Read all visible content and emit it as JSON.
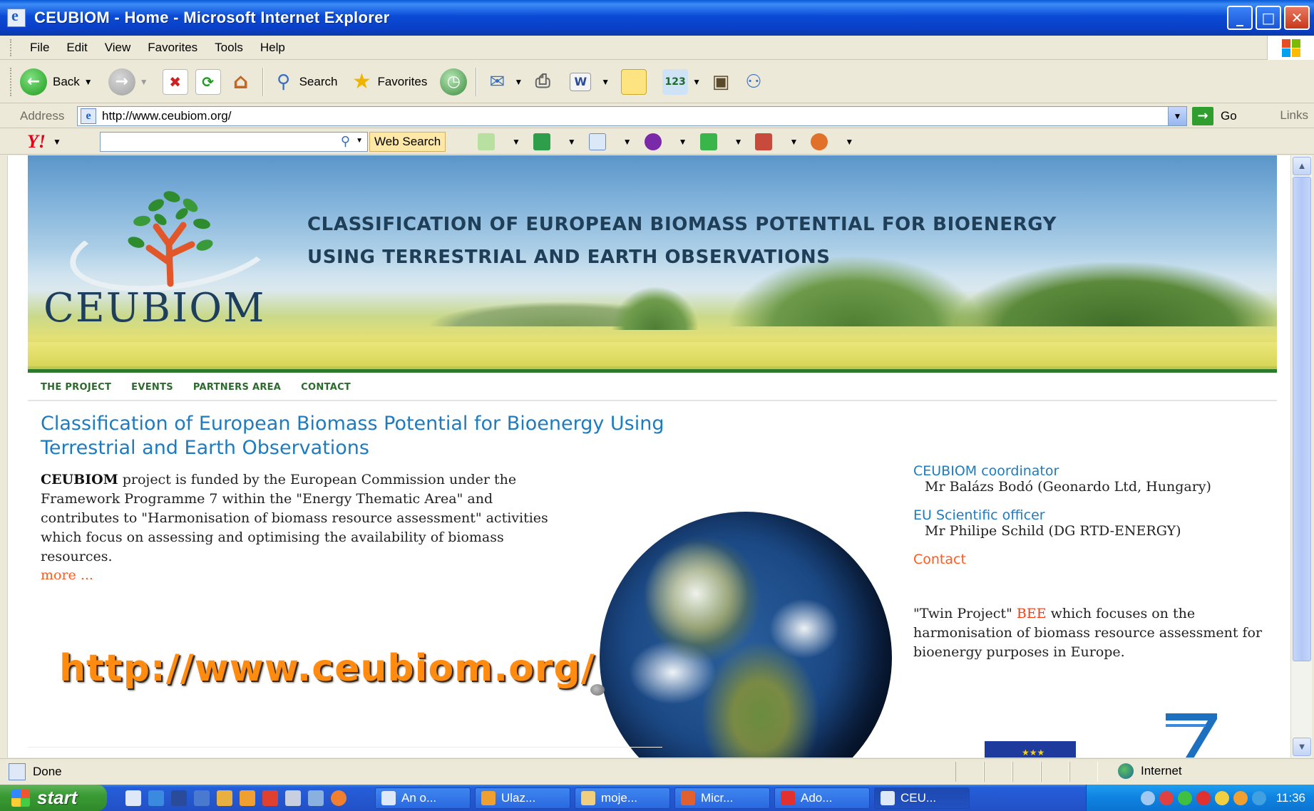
{
  "window": {
    "title": "CEUBIOM - Home - Microsoft Internet Explorer",
    "controls": {
      "minimize": "_",
      "maximize": "□",
      "close": "✕"
    }
  },
  "menu": [
    "File",
    "Edit",
    "View",
    "Favorites",
    "Tools",
    "Help"
  ],
  "toolbar": {
    "back_label": "Back",
    "search_label": "Search",
    "favorites_label": "Favorites"
  },
  "address": {
    "label": "Address",
    "url": "http://www.ceubiom.org/",
    "go_label": "Go",
    "links_label": "Links"
  },
  "yahoo": {
    "logo": "Y!",
    "search_value": "",
    "web_search_label": "Web Search"
  },
  "page": {
    "banner": {
      "line1": "CLASSIFICATION OF EUROPEAN BIOMASS POTENTIAL FOR BIOENERGY",
      "line2": "USING TERRESTRIAL AND EARTH OBSERVATIONS",
      "logo_text": "CEUBIOM"
    },
    "nav": [
      "THE PROJECT",
      "EVENTS",
      "PARTNERS AREA",
      "CONTACT"
    ],
    "title": "Classification of European Biomass Potential for Bioenergy Using Terrestrial and Earth Observations",
    "intro_bold": "CEUBIOM",
    "intro_text": " project is funded by the European Commission under the Framework Programme 7 within the \"Energy Thematic Area\" and contributes to \"Harmonisation of biomass resource assessment\" activities which focus on assessing and optimising the availability of biomass resources.",
    "more_label": "more ...",
    "overlay_url": "http://www.ceubiom.org/",
    "side": {
      "coordinator_label": "CEUBIOM coordinator",
      "coordinator_value": "Mr Balázs Bodó (Geonardo Ltd, Hungary)",
      "officer_label": "EU Scientific officer",
      "officer_value": "Mr Philipe Schild (DG RTD-ENERGY)",
      "contact_label": "Contact",
      "twin_pre": "\"Twin Project\" ",
      "twin_link": "BEE",
      "twin_post": " which focuses on the harmonisation of biomass resource assessment for bioenergy purposes in Europe."
    }
  },
  "status": {
    "text": "Done",
    "zone": "Internet"
  },
  "taskbar": {
    "start_label": "start",
    "tasks": [
      "An o...",
      "Ulaz...",
      "moje...",
      "Micr...",
      "Ado...",
      "CEU..."
    ],
    "clock": "11:36"
  },
  "colors": {
    "link_blue": "#1d7bc0",
    "accent_orange": "#ff5a1f",
    "nav_green": "#2d6a2d",
    "xp_blue": "#0a4bd6"
  }
}
